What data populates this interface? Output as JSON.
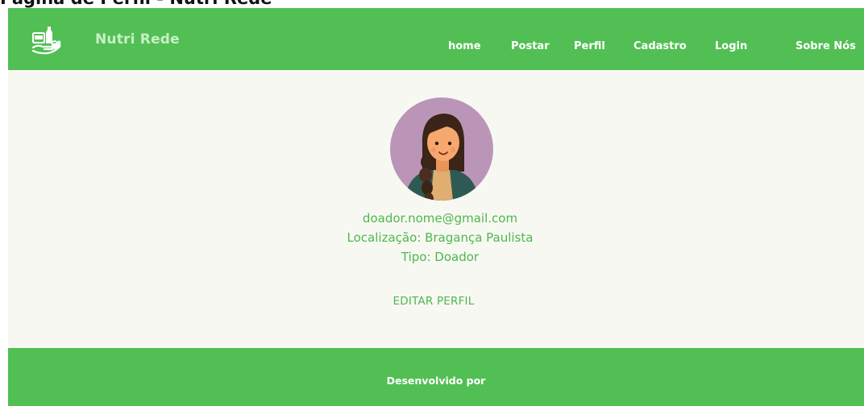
{
  "page": {
    "caption": "Página de Perfil - Nutri Rede"
  },
  "navbar": {
    "brand": "Nutri Rede",
    "logo_icon": "food-donation-hand-icon",
    "items": [
      {
        "label": "home"
      },
      {
        "label": "Postar"
      },
      {
        "label": "Perfil"
      },
      {
        "label": "Cadastro"
      },
      {
        "label": "Login"
      },
      {
        "label": "Sobre Nós"
      }
    ]
  },
  "profile": {
    "avatar_icon": "woman-avatar-icon",
    "email": "doador.nome@gmail.com",
    "location": "Localização: Bragança Paulista",
    "type": "Tipo: Doador",
    "edit_label": "EDITAR PERFIL"
  },
  "footer": {
    "text": "Desenvolvido por"
  },
  "colors": {
    "primary_green": "#52bf54",
    "text_green": "#4cb84e",
    "brand_text": "#c9efc9",
    "background": "#f8f8f2",
    "avatar_bg": "#bb95b7"
  }
}
